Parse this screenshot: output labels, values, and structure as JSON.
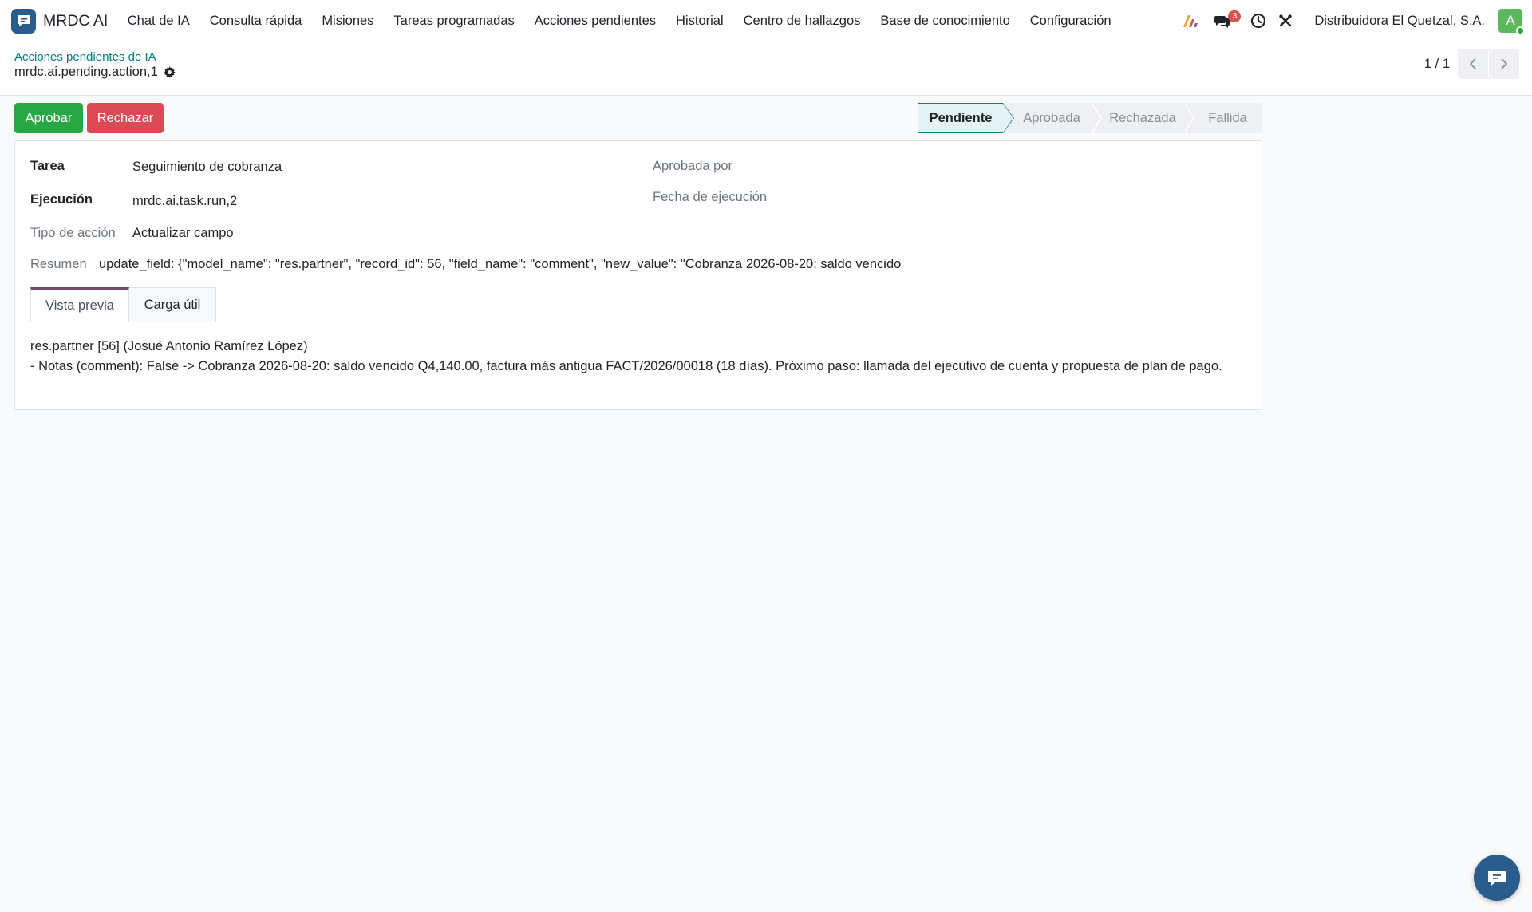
{
  "app": {
    "name": "MRDC AI"
  },
  "nav": {
    "items": [
      "Chat de IA",
      "Consulta rápida",
      "Misiones",
      "Tareas programadas",
      "Acciones pendientes",
      "Historial",
      "Centro de hallazgos",
      "Base de conocimiento",
      "Configuración"
    ],
    "messages_badge": "3",
    "company": "Distribuidora El Quetzal, S.A.",
    "avatar_letter": "A"
  },
  "breadcrumb": {
    "parent": "Acciones pendientes de IA",
    "current": "mrdc.ai.pending.action,1"
  },
  "pager": {
    "value": "1 / 1"
  },
  "actions": {
    "approve": "Aprobar",
    "reject": "Rechazar"
  },
  "status": {
    "stages": [
      "Pendiente",
      "Aprobada",
      "Rechazada",
      "Fallida"
    ],
    "current": "Pendiente"
  },
  "form": {
    "task_label": "Tarea",
    "task_value": "Seguimiento de cobranza",
    "run_label": "Ejecución",
    "run_value": "mrdc.ai.task.run,2",
    "action_type_label": "Tipo de acción",
    "action_type_value": "Actualizar campo",
    "approved_by_label": "Aprobada por",
    "execution_date_label": "Fecha de ejecución",
    "summary_label": "Resumen",
    "summary_value": "update_field: {\"model_name\": \"res.partner\", \"record_id\": 56, \"field_name\": \"comment\", \"new_value\": \"Cobranza 2026-08-20: saldo vencido"
  },
  "tabs": {
    "preview": "Vista previa",
    "payload": "Carga útil"
  },
  "preview": {
    "line1": "res.partner [56] (Josué Antonio Ramírez López)",
    "line2": "- Notas (comment): False -> Cobranza 2026-08-20: saldo vencido Q4,140.00, factura más antigua FACT/2026/00018 (18 días). Próximo paso: llamada del ejecutivo de cuenta y propuesta de plan de pago."
  },
  "colors": {
    "brand": "#2a5d8c",
    "approve": "#28a745",
    "reject": "#dc4a55",
    "link": "#017e84",
    "tab_accent": "#714b67"
  }
}
